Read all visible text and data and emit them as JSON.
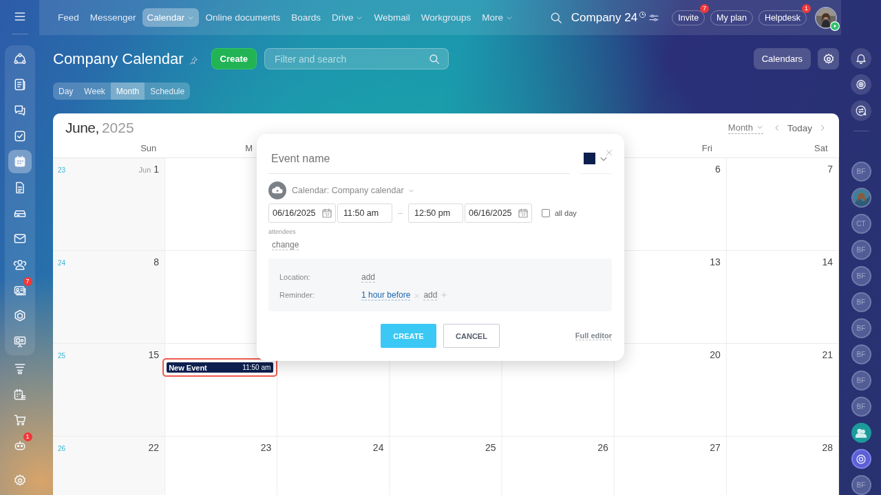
{
  "sidebar": {
    "pinned": [
      {
        "selected": false
      },
      {
        "selected": false
      },
      {
        "selected": false
      },
      {
        "selected": false
      },
      {
        "selected": true
      },
      {
        "selected": false
      },
      {
        "selected": false
      },
      {
        "selected": false
      },
      {
        "selected": false
      },
      {
        "selected": false,
        "badge": "7"
      },
      {
        "selected": false
      },
      {
        "selected": false
      }
    ],
    "items": [
      {
        "selected": false
      },
      {
        "selected": false
      },
      {
        "selected": false
      },
      {
        "selected": false,
        "badge": "1"
      }
    ]
  },
  "topbar": {
    "nav": [
      {
        "label": "Feed",
        "selected": false,
        "menu": false
      },
      {
        "label": "Messenger",
        "selected": false,
        "menu": false
      },
      {
        "label": "Calendar",
        "selected": true,
        "menu": true
      },
      {
        "label": "Online documents",
        "selected": false,
        "menu": false
      },
      {
        "label": "Boards",
        "selected": false,
        "menu": false
      },
      {
        "label": "Drive",
        "selected": false,
        "menu": true
      },
      {
        "label": "Webmail",
        "selected": false,
        "menu": false
      },
      {
        "label": "Workgroups",
        "selected": false,
        "menu": false
      },
      {
        "label": "More",
        "selected": false,
        "menu": true
      }
    ],
    "company": "Company 24",
    "buttons": [
      {
        "label": "Invite",
        "badge": "7"
      },
      {
        "label": "My plan"
      },
      {
        "label": "Helpdesk",
        "badge": "1"
      }
    ]
  },
  "page": {
    "title": "Company Calendar",
    "create_button": "Create",
    "filter": {
      "placeholder": "Filter and search"
    },
    "calendars_button": "Calendars",
    "view_tabs": [
      {
        "label": "Day",
        "selected": false
      },
      {
        "label": "Week",
        "selected": false
      },
      {
        "label": "Month",
        "selected": true
      },
      {
        "label": "Schedule",
        "selected": false
      }
    ]
  },
  "calendar": {
    "month": "June,",
    "year": "2025",
    "view_menu": "Month",
    "today": "Today",
    "weekdays": {
      "sun": "Sun",
      "mon": "M",
      "fri": "Fri",
      "sat": "Sat"
    },
    "weeks": [
      {
        "number": "23",
        "days": {
          "sun": {
            "month": "Jun",
            "day": "1"
          },
          "fri": {
            "day": "6"
          },
          "sat": {
            "day": "7"
          }
        }
      },
      {
        "number": "24",
        "days": {
          "sun": {
            "day": "8"
          },
          "fri": {
            "day": "13"
          },
          "sat": {
            "day": "14"
          }
        }
      },
      {
        "number": "25",
        "days": {
          "sun": {
            "day": "15"
          },
          "mon": {
            "events": [
              {
                "title": "New Event",
                "time": "11:50 am",
                "color": "#0c1f4e",
                "highlighted": true
              }
            ]
          },
          "fri": {
            "day": "20"
          },
          "sat": {
            "day": "21"
          }
        }
      },
      {
        "number": "26",
        "days": {
          "sun": {
            "day": "22"
          },
          "mon": {
            "day": "23"
          },
          "tue": {
            "day": "24"
          },
          "wed": {
            "day": "25"
          },
          "thu": {
            "day": "26"
          },
          "fri": {
            "day": "27"
          },
          "sat": {
            "day": "28"
          }
        }
      }
    ]
  },
  "popup": {
    "name": {
      "placeholder": "Event name"
    },
    "color": "#0c1f4e",
    "calendar": "Calendar: Company calendar",
    "start_date": "06/16/2025",
    "start_time": "11:50 am",
    "end_time": "12:50 pm",
    "end_date": "06/16/2025",
    "all_day": {
      "label": "all day",
      "checked": false
    },
    "attendees_label": "attendees",
    "attendees_link": "change",
    "location_label": "Location:",
    "location_link": "add",
    "reminder_label": "Reminder:",
    "reminder": "1 hour before",
    "reminder_add": "add",
    "create": "CREATE",
    "cancel": "CANCEL",
    "full_editor": "Full editor"
  },
  "right_bar": {
    "avatars": [
      {
        "kind": "initials",
        "initials": "BF"
      },
      {
        "kind": "picture"
      },
      {
        "kind": "initials",
        "initials": "CT"
      },
      {
        "kind": "initials",
        "initials": "BF"
      },
      {
        "kind": "initials",
        "initials": "BF"
      },
      {
        "kind": "initials",
        "initials": "BF"
      },
      {
        "kind": "initials",
        "initials": "BF"
      },
      {
        "kind": "initials",
        "initials": "BF"
      },
      {
        "kind": "initials",
        "initials": "BF"
      },
      {
        "kind": "initials",
        "initials": "BF"
      },
      {
        "kind": "group"
      },
      {
        "kind": "app"
      },
      {
        "kind": "initials",
        "initials": "BF"
      }
    ]
  }
}
